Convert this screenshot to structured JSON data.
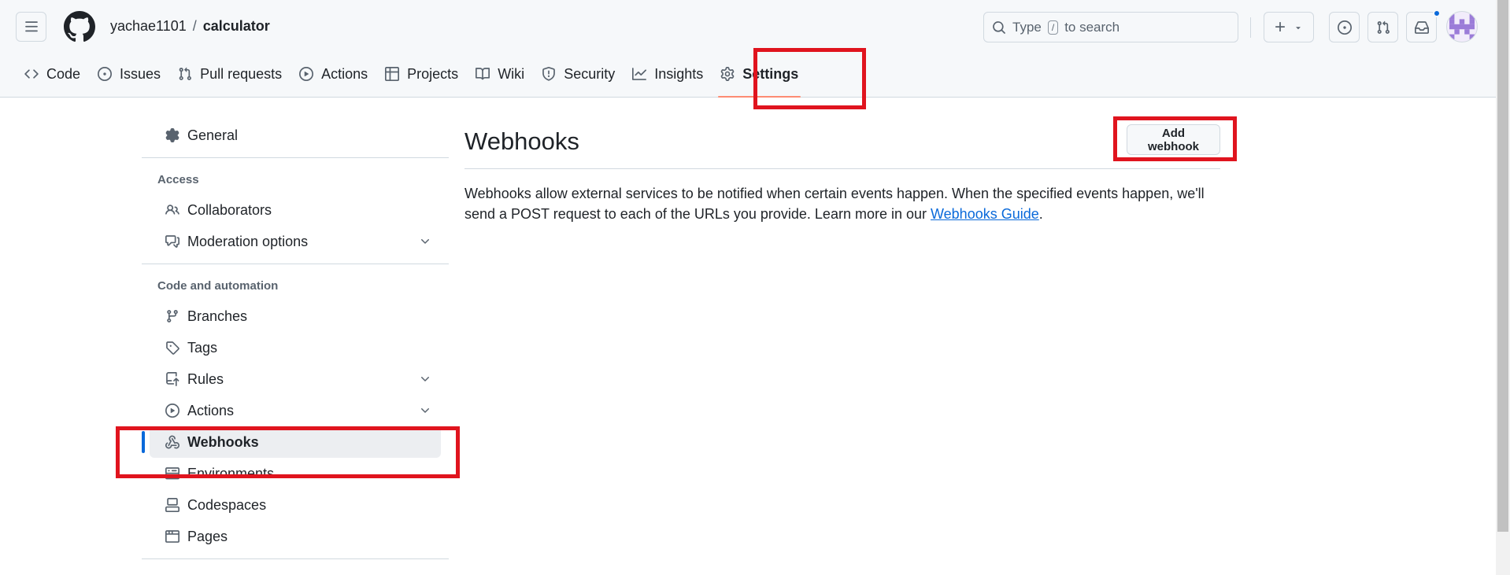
{
  "header": {
    "owner": "yachae1101",
    "separator": "/",
    "repo": "calculator",
    "search_prefix": "Type",
    "search_key": "/",
    "search_suffix": "to search",
    "plus_label": "+"
  },
  "tabs": [
    {
      "label": "Code",
      "icon": "code-icon"
    },
    {
      "label": "Issues",
      "icon": "issue-icon"
    },
    {
      "label": "Pull requests",
      "icon": "pull-request-icon"
    },
    {
      "label": "Actions",
      "icon": "play-icon"
    },
    {
      "label": "Projects",
      "icon": "table-icon"
    },
    {
      "label": "Wiki",
      "icon": "book-icon"
    },
    {
      "label": "Security",
      "icon": "shield-icon"
    },
    {
      "label": "Insights",
      "icon": "graph-icon"
    },
    {
      "label": "Settings",
      "icon": "gear-icon",
      "active": true
    }
  ],
  "sidebar": {
    "general": "General",
    "access_heading": "Access",
    "collaborators": "Collaborators",
    "moderation": "Moderation options",
    "code_heading": "Code and automation",
    "branches": "Branches",
    "tags": "Tags",
    "rules": "Rules",
    "actions": "Actions",
    "webhooks": "Webhooks",
    "environments": "Environments",
    "codespaces": "Codespaces",
    "pages": "Pages"
  },
  "main": {
    "title": "Webhooks",
    "add_button": "Add webhook",
    "desc_text": "Webhooks allow external services to be notified when certain events happen. When the specified events happen, we'll send a POST request to each of the URLs you provide. Learn more in our ",
    "desc_link": "Webhooks Guide",
    "desc_end": "."
  },
  "colors": {
    "accent": "#0969da",
    "highlight": "#e0141e",
    "tab_underline": "#fd8c73"
  }
}
